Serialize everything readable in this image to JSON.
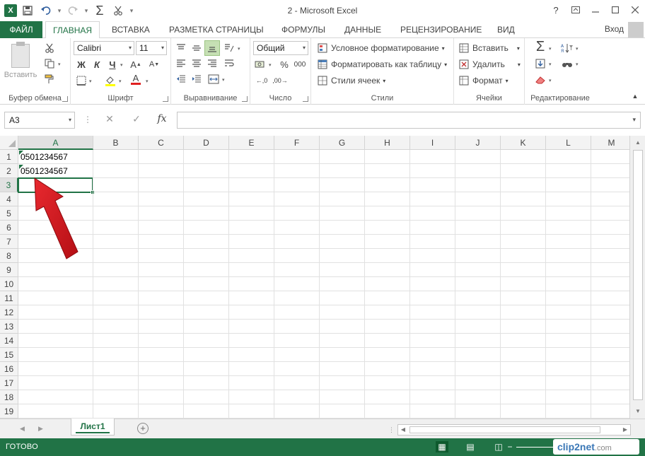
{
  "window": {
    "title": "2 - Microsoft Excel",
    "signin": "Вход",
    "help": "?",
    "controls": [
      "restore-ribbon",
      "minimize",
      "maximize",
      "close"
    ]
  },
  "qat": {
    "logo": "X",
    "sum_icon": "Σ"
  },
  "tabs": {
    "file": "ФАЙЛ",
    "items": [
      "ГЛАВНАЯ",
      "ВСТАВКА",
      "РАЗМЕТКА СТРАНИЦЫ",
      "ФОРМУЛЫ",
      "ДАННЫЕ",
      "РЕЦЕНЗИРОВАНИЕ",
      "ВИД"
    ],
    "active": "ГЛАВНАЯ"
  },
  "ribbon": {
    "clipboard": {
      "label": "Буфер обмена",
      "paste": "Вставить"
    },
    "font": {
      "label": "Шрифт",
      "font_name": "Calibri",
      "font_size": "11",
      "bold": "Ж",
      "italic": "К",
      "underline": "Ч",
      "font_color_letter": "А"
    },
    "alignment": {
      "label": "Выравнивание"
    },
    "number": {
      "label": "Число",
      "format": "Общий",
      "percent": "%",
      "thousands": "000"
    },
    "styles": {
      "label": "Стили",
      "conditional": "Условное форматирование",
      "format_table": "Форматировать как таблицу",
      "cell_styles": "Стили ячеек"
    },
    "cells": {
      "label": "Ячейки",
      "insert": "Вставить",
      "delete": "Удалить",
      "format": "Формат"
    },
    "editing": {
      "label": "Редактирование",
      "sum": "Σ"
    }
  },
  "formula_bar": {
    "name_box": "A3",
    "fx": "fx",
    "formula": ""
  },
  "grid": {
    "columns": [
      "A",
      "B",
      "C",
      "D",
      "E",
      "F",
      "G",
      "H",
      "I",
      "J",
      "K",
      "L",
      "M"
    ],
    "rows": [
      "1",
      "2",
      "3",
      "4",
      "5",
      "6",
      "7",
      "8",
      "9",
      "10",
      "11",
      "12",
      "13",
      "14",
      "15",
      "16",
      "17",
      "18",
      "19"
    ],
    "selected_column": "A",
    "selected_row": "3",
    "cells": {
      "A1": "0501234567",
      "A2": "0501234567"
    }
  },
  "sheets": {
    "tabs": [
      "Лист1"
    ],
    "active": "Лист1",
    "add": "+"
  },
  "status": {
    "text": "ГОТОВО",
    "watermark": "clip2net",
    "watermark_suffix": ".com"
  },
  "colors": {
    "accent": "#217346",
    "arrow": "#d2151c"
  }
}
